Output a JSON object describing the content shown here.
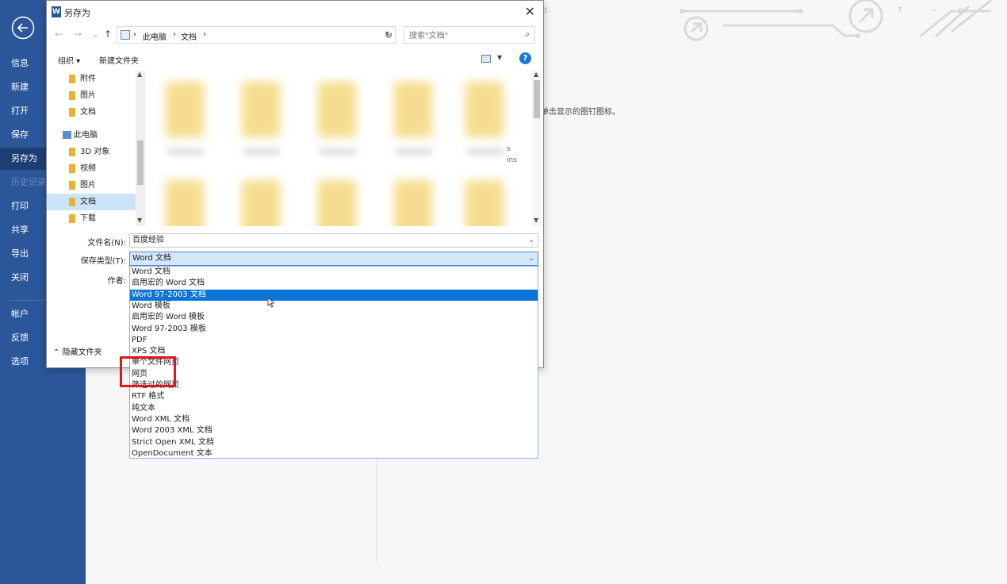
{
  "backstage": {
    "nav": [
      {
        "label": "信息",
        "state": "normal"
      },
      {
        "label": "新建",
        "state": "normal"
      },
      {
        "label": "打开",
        "state": "normal"
      },
      {
        "label": "保存",
        "state": "normal"
      },
      {
        "label": "另存为",
        "state": "active"
      },
      {
        "label": "历史记录",
        "state": "disabled"
      },
      {
        "label": "打印",
        "state": "normal"
      },
      {
        "label": "共享",
        "state": "normal"
      },
      {
        "label": "导出",
        "state": "normal"
      },
      {
        "label": "关闭",
        "state": "normal"
      },
      {
        "label": "帐户",
        "state": "normal"
      },
      {
        "label": "反馈",
        "state": "normal"
      },
      {
        "label": "选项",
        "state": "normal"
      }
    ],
    "pin_hint": "单击显示的图钉图标。",
    "faint_char": "d",
    "help_glyph": "?",
    "min_glyph": "–",
    "max_glyph": "▫",
    "accent_color": "#2b579a"
  },
  "dialog": {
    "title": "另存为",
    "close_glyph": "✕",
    "nav": {
      "back": "←",
      "forward": "→",
      "recent": "⌄",
      "up": "↑"
    },
    "breadcrumb": [
      "此电脑",
      "文档"
    ],
    "breadcrumb_sep": "›",
    "search_placeholder": "搜索\"文档\"",
    "toolbar": {
      "organize": "组织 ▾",
      "new_folder": "新建文件夹"
    },
    "tree": [
      {
        "label": "附件",
        "icon": "folder-icon"
      },
      {
        "label": "图片",
        "icon": "folder-icon"
      },
      {
        "label": "文档",
        "icon": "folder-icon"
      },
      {
        "label": "此电脑",
        "icon": "pc-icon"
      },
      {
        "label": "3D 对象",
        "icon": "folder-icon"
      },
      {
        "label": "视频",
        "icon": "folder-icon"
      },
      {
        "label": "图片",
        "icon": "folder-icon"
      },
      {
        "label": "文档",
        "icon": "folder-icon"
      },
      {
        "label": "下载",
        "icon": "folder-icon"
      }
    ],
    "peek_text": [
      "s",
      "ins"
    ],
    "filename_label": "文件名(N):",
    "filename_value": "百度经验",
    "filetype_label": "保存类型(T):",
    "filetype_value": "Word 文档",
    "author_label": "作者:",
    "hide_folders": "隐藏文件夹",
    "filetype_options": [
      "Word 文档",
      "启用宏的 Word 文档",
      "Word 97-2003 文档",
      "Word 模板",
      "启用宏的 Word 模板",
      "Word 97-2003 模板",
      "PDF",
      "XPS 文档",
      "单个文件网页",
      "网页",
      "筛选过的网页",
      "RTF 格式",
      "纯文本",
      "Word XML 文档",
      "Word 2003 XML 文档",
      "Strict Open XML 文档",
      "OpenDocument 文本"
    ],
    "highlighted_option": "Word 97-2003 文档",
    "annotation_color": "#e0161b"
  }
}
